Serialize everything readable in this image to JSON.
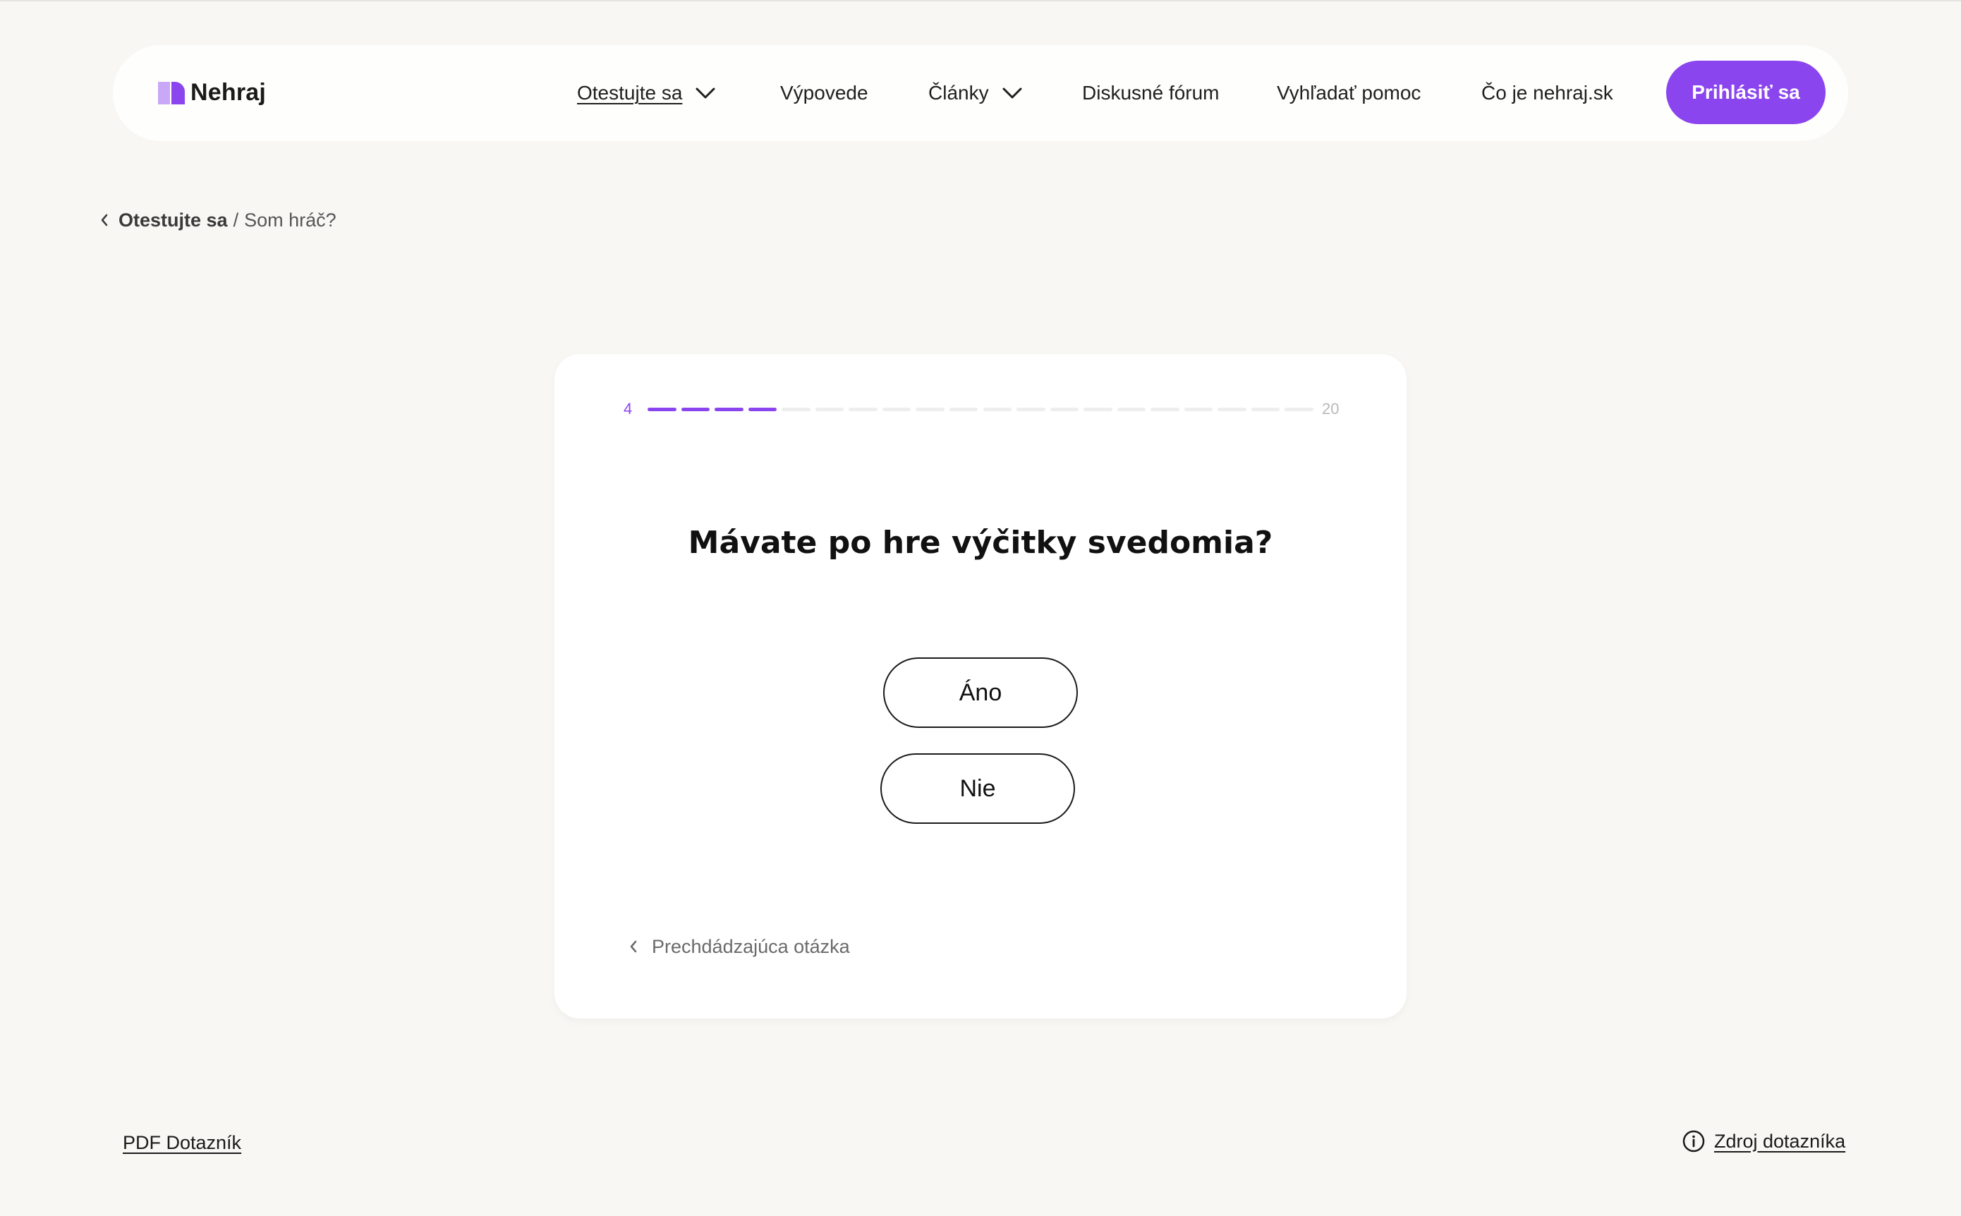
{
  "brand": {
    "name": "Nehraj",
    "accent": "#8b45ef",
    "accent_light": "#c9a9f7"
  },
  "nav": {
    "items": [
      {
        "label": "Otestujte sa",
        "has_dropdown": true,
        "active": true
      },
      {
        "label": "Výpovede",
        "has_dropdown": false
      },
      {
        "label": "Články",
        "has_dropdown": true
      },
      {
        "label": "Diskusné fórum",
        "has_dropdown": false
      },
      {
        "label": "Vyhľadať pomoc",
        "has_dropdown": false
      },
      {
        "label": "Čo je nehraj.sk",
        "has_dropdown": false
      }
    ],
    "login_label": "Prihlásiť sa"
  },
  "breadcrumb": {
    "parent": "Otestujte sa",
    "separator": "/",
    "current": "Som hráč?"
  },
  "quiz": {
    "current_question": 4,
    "total_questions": 20,
    "current_label": "4",
    "total_label": "20",
    "question": "Mávate po hre výčitky svedomia?",
    "answers": {
      "yes": "Áno",
      "no": "Nie"
    },
    "previous_label": "Prechdádzajúca otázka"
  },
  "footer": {
    "pdf_label": "PDF Dotazník",
    "source_label": "Zdroj dotazníka"
  },
  "icons": {
    "chevron": "chevron-down-icon",
    "back": "chevron-left-icon",
    "info": "info-icon"
  }
}
